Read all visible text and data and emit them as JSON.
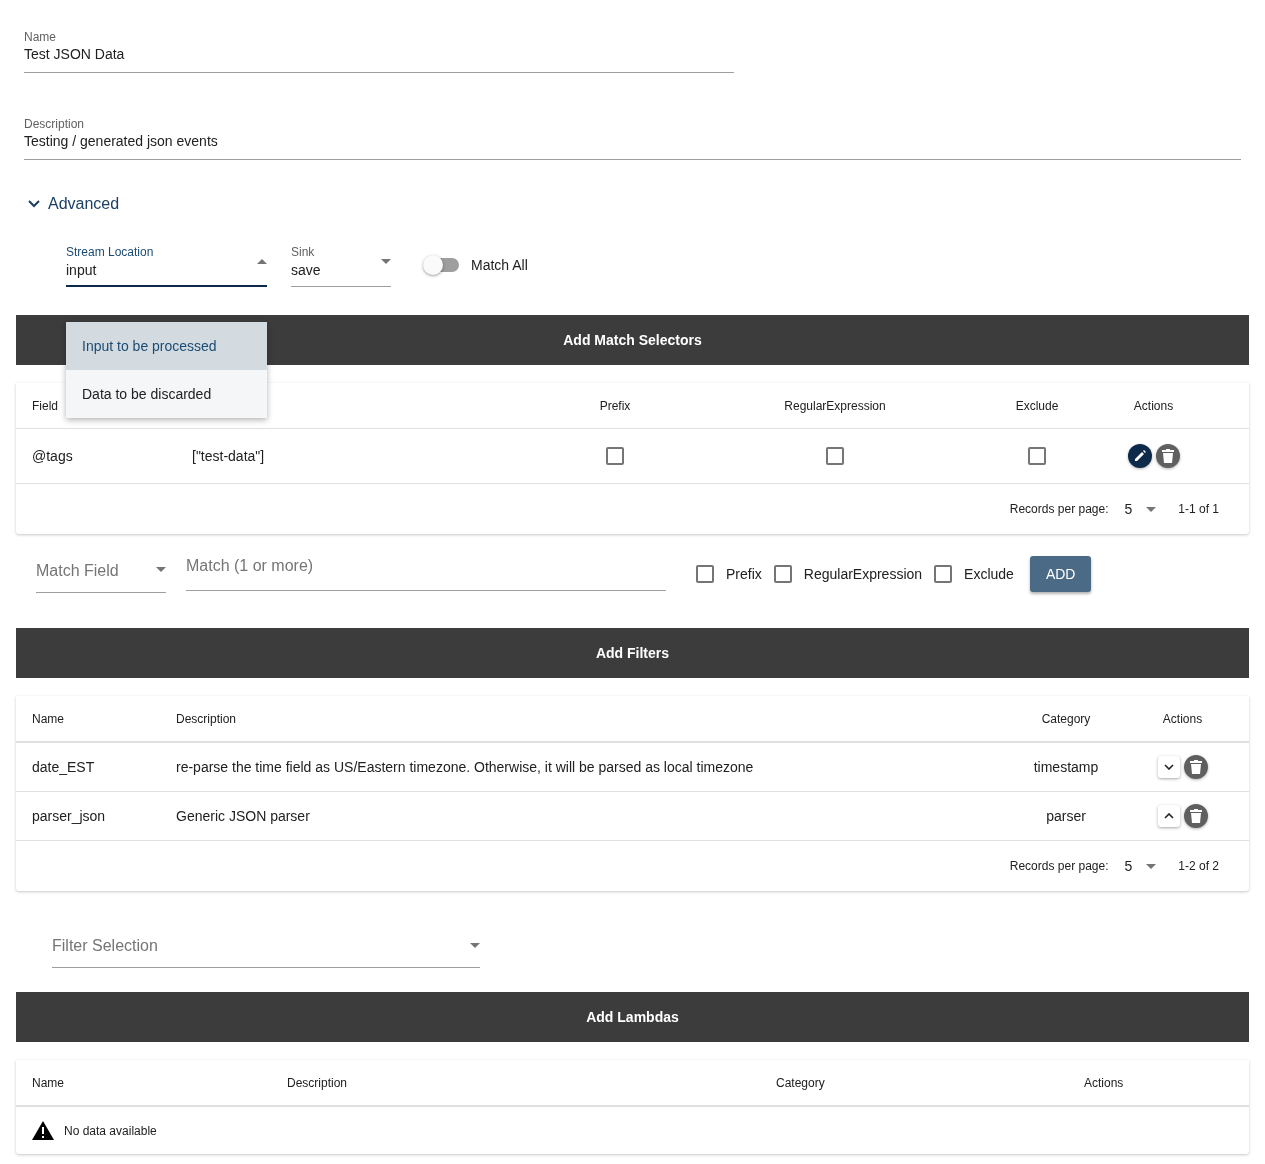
{
  "name_field": {
    "label": "Name",
    "value": "Test JSON Data"
  },
  "description_field": {
    "label": "Description",
    "value": "Testing / generated json events"
  },
  "advanced": {
    "label": "Advanced",
    "expanded": true,
    "stream_location": {
      "label": "Stream Location",
      "value": "input",
      "expanded": true,
      "options": [
        {
          "label": "Input to be processed",
          "selected": true
        },
        {
          "label": "Data to be discarded",
          "selected": false
        }
      ]
    },
    "sink": {
      "label": "Sink",
      "value": "save",
      "expanded": false
    },
    "match_all": {
      "label": "Match All",
      "on": false
    }
  },
  "match_selectors": {
    "title": "Add Match Selectors",
    "columns": [
      "Field",
      "Prefix",
      "RegularExpression",
      "Exclude",
      "Actions"
    ],
    "rows": [
      {
        "field": "@tags",
        "match": "[\"test-data\"]",
        "prefix": false,
        "regular_expression": false,
        "exclude": false
      }
    ],
    "records_per_page_label": "Records per page:",
    "records_per_page": "5",
    "range": "1-1 of 1",
    "add_form": {
      "match_field": {
        "placeholder": "Match Field"
      },
      "match": {
        "placeholder": "Match (1 or more)"
      },
      "options": [
        {
          "label": "Prefix",
          "checked": false
        },
        {
          "label": "RegularExpression",
          "checked": false
        },
        {
          "label": "Exclude",
          "checked": false
        }
      ],
      "button": "ADD"
    }
  },
  "filters": {
    "title": "Add Filters",
    "columns": [
      "Name",
      "Description",
      "Category",
      "Actions"
    ],
    "rows": [
      {
        "name": "date_EST",
        "description": "re-parse the time field as US/Eastern timezone. Otherwise, it will be parsed as local timezone",
        "category": "timestamp",
        "expanded": false
      },
      {
        "name": "parser_json",
        "description": "Generic JSON parser",
        "category": "parser",
        "expanded": true
      }
    ],
    "records_per_page_label": "Records per page:",
    "records_per_page": "5",
    "range": "1-2 of 2",
    "filter_selection": {
      "placeholder": "Filter Selection"
    }
  },
  "lambdas": {
    "title": "Add Lambdas",
    "columns": [
      "Name",
      "Description",
      "Category",
      "Actions"
    ],
    "empty_message": "No data available"
  }
}
